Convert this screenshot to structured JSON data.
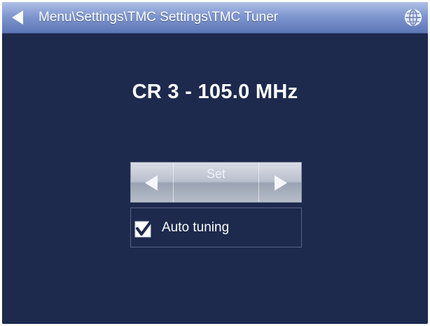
{
  "titlebar": {
    "path": "Menu\\Settings\\TMC Settings\\TMC Tuner",
    "back_icon": "back-arrow-icon",
    "globe_icon": "globe-icon"
  },
  "station": {
    "label": "CR 3 - 105.0 MHz"
  },
  "tuner": {
    "set_label": "Set",
    "prev_icon": "left-arrow-icon",
    "next_icon": "right-arrow-icon"
  },
  "auto_tuning": {
    "label": "Auto tuning",
    "checked": true
  },
  "colors": {
    "background": "#1d2a4e",
    "titlebar": "#7f97cf",
    "text": "#ffffff"
  }
}
